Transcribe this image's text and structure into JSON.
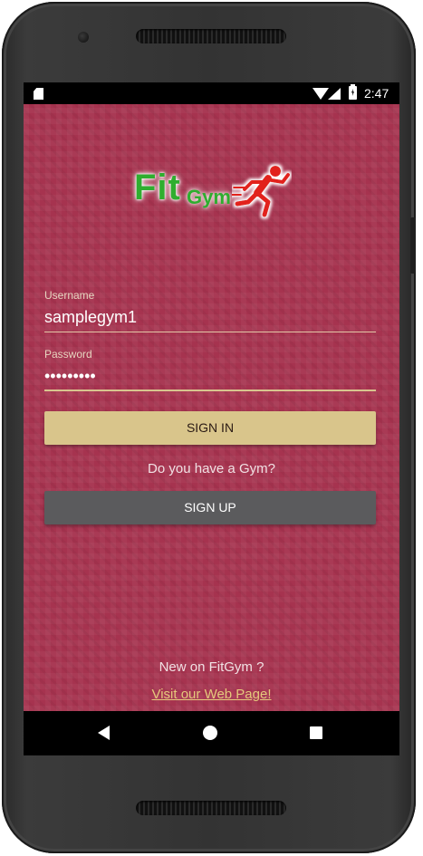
{
  "status_bar": {
    "time": "2:47"
  },
  "logo": {
    "brand_fit": "Fit",
    "brand_gym": "Gym"
  },
  "login_form": {
    "username_label": "Username",
    "username_value": "samplegym1",
    "password_label": "Password",
    "password_value": "•••••••••",
    "sign_in_label": "SIGN IN"
  },
  "gym_prompt": {
    "question": "Do you have a Gym?",
    "sign_up_label": "SIGN UP"
  },
  "footer": {
    "new_text": "New on FitGym ?",
    "web_link": "Visit our Web Page!"
  },
  "colors": {
    "background": "#a6334f",
    "sign_in_button": "#d9c58b",
    "sign_up_button": "#5b5b5d",
    "link": "#e5c87c",
    "brand_green": "#2fae2f",
    "runner_red": "#e2231a"
  },
  "icons": [
    "sd-card-icon",
    "wifi-icon",
    "signal-icon",
    "battery-charging-icon",
    "runner-icon",
    "back-icon",
    "home-icon",
    "recents-icon"
  ]
}
